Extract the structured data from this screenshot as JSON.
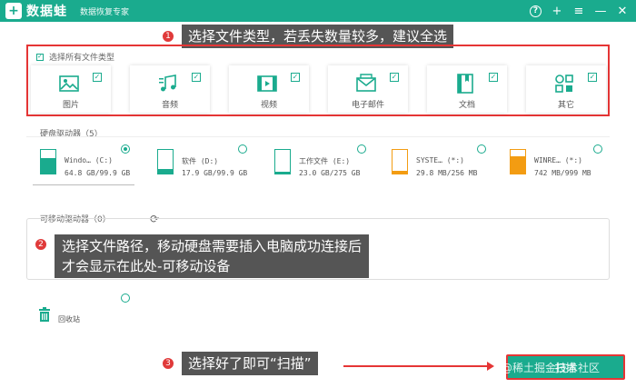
{
  "window": {
    "logo_char": "+",
    "app_name": "数据蛙",
    "app_subtitle": "数据恢复专家",
    "buttons": {
      "help": "?",
      "add": "+",
      "menu": "≡",
      "minimize": "—",
      "close": "✕"
    }
  },
  "annotations": {
    "one": {
      "num": "1",
      "text": "选择文件类型，若丢失数量较多，建议全选"
    },
    "two": {
      "num": "2",
      "line1": "选择文件路径，移动硬盘需要插入电脑成功连接后",
      "line2": "才会显示在此处-可移动设备"
    },
    "three": {
      "num": "3",
      "text": "选择好了即可“扫描”"
    }
  },
  "file_types": {
    "select_all_label": "选择所有文件类型",
    "items": [
      {
        "label": "图片",
        "icon": "image-icon",
        "checked": true
      },
      {
        "label": "音频",
        "icon": "music-icon",
        "checked": true
      },
      {
        "label": "视频",
        "icon": "video-icon",
        "checked": true
      },
      {
        "label": "电子邮件",
        "icon": "email-icon",
        "checked": true
      },
      {
        "label": "文档",
        "icon": "document-icon",
        "checked": true
      },
      {
        "label": "其它",
        "icon": "other-icon",
        "checked": true
      }
    ]
  },
  "disks": {
    "section_label": "硬盘驱动器（5）",
    "items": [
      {
        "name": "Windo… (C:)",
        "size": "64.8 GB/99.9 GB",
        "selected": true,
        "fill_fraction": 0.65,
        "color": "#1aab8e"
      },
      {
        "name": "软件 (D:)",
        "size": "17.9 GB/99.9 GB",
        "selected": false,
        "fill_fraction": 0.18,
        "color": "#1aab8e"
      },
      {
        "name": "工作文件 (E:)",
        "size": "23.0 GB/275 GB",
        "selected": false,
        "fill_fraction": 0.08,
        "color": "#1aab8e"
      },
      {
        "name": "SYSTE… (*:)",
        "size": "29.8 MB/256 MB",
        "selected": false,
        "fill_fraction": 0.12,
        "color": "#f39c12"
      },
      {
        "name": "WINRE… (*:)",
        "size": "742 MB/999 MB",
        "selected": false,
        "fill_fraction": 0.74,
        "color": "#f39c12"
      }
    ]
  },
  "removable": {
    "section_label": "可移动驱动器（0）"
  },
  "recycle_bin": {
    "label": "回收站"
  },
  "scan_button": {
    "label": "扫描"
  },
  "watermark": "@稀土掘金技术社区"
}
